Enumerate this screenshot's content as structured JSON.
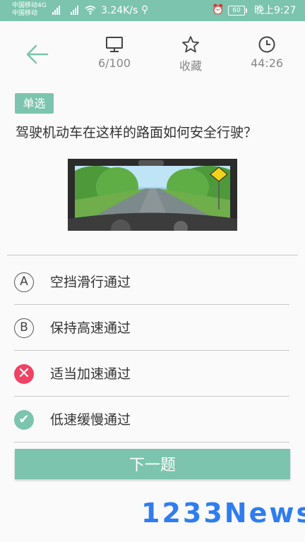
{
  "status_bar": {
    "carrier_1": "中国移动4G",
    "carrier_2": "中国移动",
    "speed": "3.24K/s",
    "battery": "60",
    "time": "晚上9:27"
  },
  "toolbar": {
    "progress": "6/100",
    "favorite_label": "收藏",
    "timer": "44:26"
  },
  "question": {
    "type_tag": "单选",
    "text": "驾驶机动车在这样的路面如何安全行驶？"
  },
  "options": [
    {
      "marker": "A",
      "text": "空挡滑行通过",
      "state": "normal"
    },
    {
      "marker": "B",
      "text": "保持高速通过",
      "state": "normal"
    },
    {
      "marker": "✕",
      "text": "适当加速通过",
      "state": "wrong"
    },
    {
      "marker": "✔",
      "text": "低速缓慢通过",
      "state": "correct"
    }
  ],
  "next_button": "下一题",
  "watermark": "1233News",
  "colors": {
    "accent": "#7cc4ad",
    "wrong": "#f04264",
    "watermark": "#2f7df0"
  }
}
